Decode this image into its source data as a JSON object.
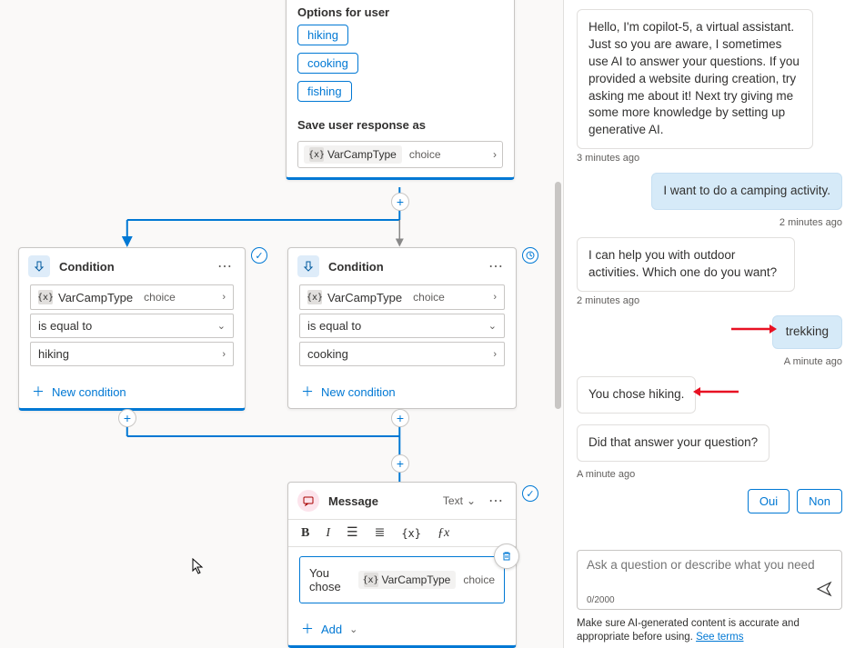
{
  "options_node": {
    "title": "Options for user",
    "chips": [
      "hiking",
      "cooking",
      "fishing"
    ],
    "save_label": "Save user response as",
    "var_name": "VarCampType",
    "var_type": "choice"
  },
  "condition_node_a": {
    "title": "Condition",
    "var_name": "VarCampType",
    "var_type": "choice",
    "operator": "is equal to",
    "value": "hiking",
    "new_cond": "New condition"
  },
  "condition_node_b": {
    "title": "Condition",
    "var_name": "VarCampType",
    "var_type": "choice",
    "operator": "is equal to",
    "value": "cooking",
    "new_cond": "New condition"
  },
  "message_node": {
    "title": "Message",
    "text_label": "Text",
    "prefix": "You chose",
    "var_name": "VarCampType",
    "var_type": "choice",
    "add_label": "Add"
  },
  "chat": {
    "msg1": "Hello, I'm copilot-5, a virtual assistant. Just so you are aware, I sometimes use AI to answer your questions. If you provided a website during creation, try asking me about it! Next try giving me some more knowledge by setting up generative AI.",
    "ts1": "3 minutes ago",
    "user1": "I want to do a camping activity.",
    "ts2": "2 minutes ago",
    "msg2": "I can help you with outdoor activities. Which one do you want?",
    "ts3": "2 minutes ago",
    "user2": "trekking",
    "ts4": "A minute ago",
    "msg3": "You chose hiking.",
    "msg4": "Did that answer your question?",
    "ts5": "A minute ago",
    "qr1": "Oui",
    "qr2": "Non",
    "placeholder": "Ask a question or describe what you need",
    "count": "0/2000",
    "disclaimer_a": "Make sure AI-generated content is accurate and appropriate before using. ",
    "disclaimer_link": "See terms"
  }
}
